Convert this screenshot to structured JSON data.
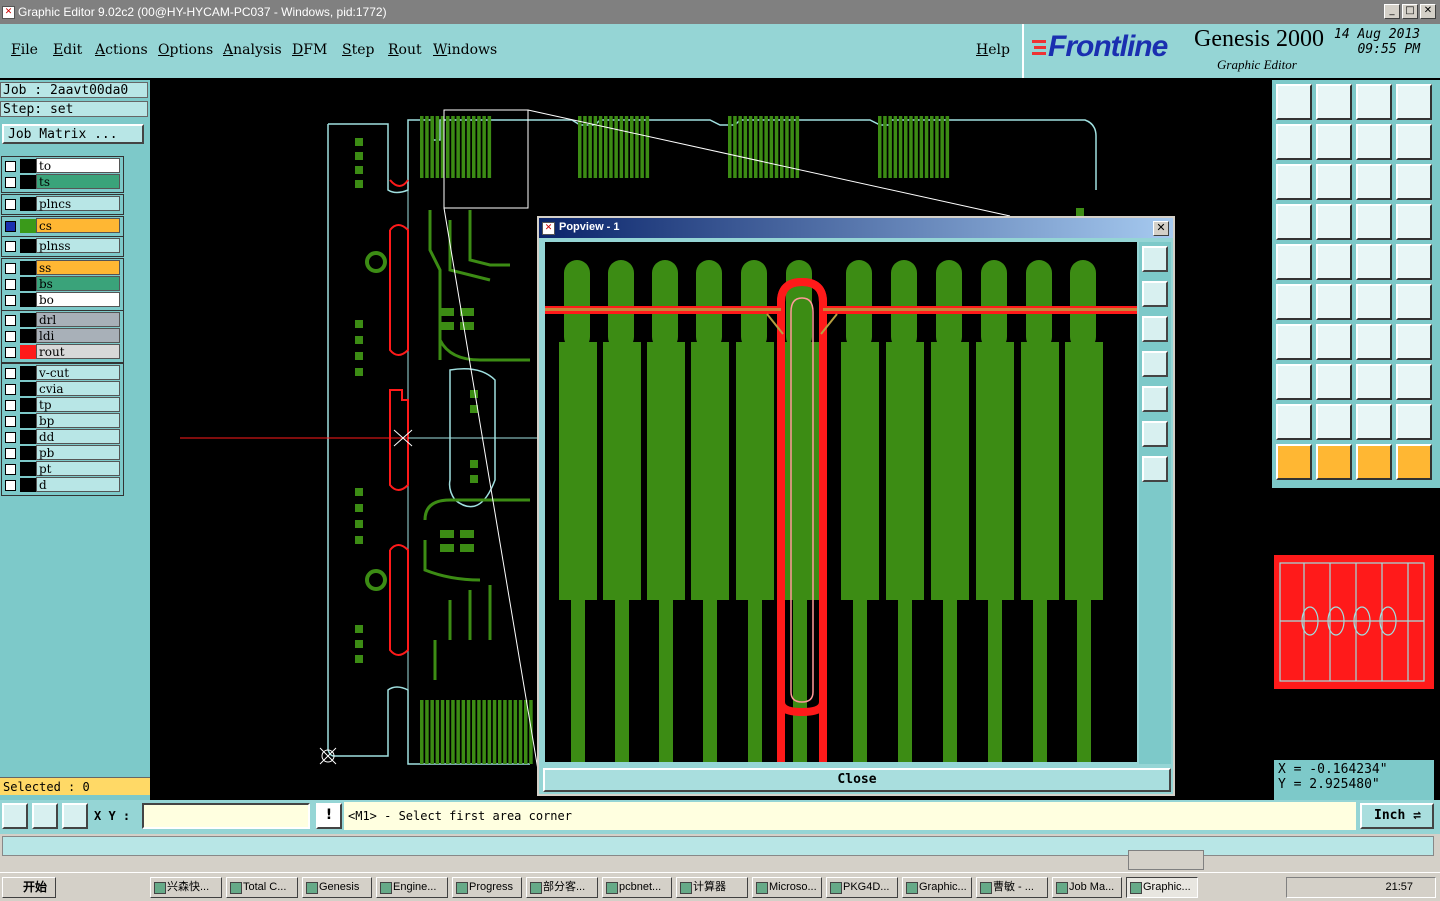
{
  "window": {
    "title": "Graphic Editor 9.02c2 (00@HY-HYCAM-PC037 - Windows, pid:1772)"
  },
  "menu": {
    "items": [
      "File",
      "Edit",
      "Actions",
      "Options",
      "Analysis",
      "DFM",
      "Step",
      "Rout",
      "Windows"
    ],
    "help": "Help"
  },
  "logo": {
    "brand": "Frontline",
    "product": "Genesis 2000",
    "subtitle": "Graphic Editor",
    "date": "14 Aug 2013",
    "time": "09:55 PM"
  },
  "job": {
    "job_line": "Job : 2aavt00da0",
    "step_line": "Step: set",
    "matrix_button": "Job Matrix ..."
  },
  "layers": [
    {
      "name": "to",
      "color": "#ffffff",
      "swatch": "#000000"
    },
    {
      "name": "ts",
      "color": "#3aa37a",
      "swatch": "#000000"
    },
    {
      "name": "plncs",
      "color": "#b8e6e6",
      "swatch": "#000000"
    },
    {
      "name": "cs",
      "color": "#ffb733",
      "swatch": "#3a9a1a"
    },
    {
      "name": "plnss",
      "color": "#b8e6e6",
      "swatch": "#000000"
    },
    {
      "name": "ss",
      "color": "#ffb733",
      "swatch": "#000000"
    },
    {
      "name": "bs",
      "color": "#3aa37a",
      "swatch": "#000000"
    },
    {
      "name": "bo",
      "color": "#ffffff",
      "swatch": "#000000"
    },
    {
      "name": "drl",
      "color": "#a8b0b8",
      "swatch": "#000000"
    },
    {
      "name": "ldi",
      "color": "#a8b0b8",
      "swatch": "#000000"
    },
    {
      "name": "rout",
      "color": "#d8d8d8",
      "swatch": "#ff1a1a"
    },
    {
      "name": "v-cut",
      "color": "#b8e6e6",
      "swatch": "#000000"
    },
    {
      "name": "cvia",
      "color": "#b8e6e6",
      "swatch": "#000000"
    },
    {
      "name": "tp",
      "color": "#b8e6e6",
      "swatch": "#000000"
    },
    {
      "name": "bp",
      "color": "#b8e6e6",
      "swatch": "#000000"
    },
    {
      "name": "dd",
      "color": "#b8e6e6",
      "swatch": "#000000"
    },
    {
      "name": "pb",
      "color": "#b8e6e6",
      "swatch": "#000000"
    },
    {
      "name": "pt",
      "color": "#b8e6e6",
      "swatch": "#000000"
    },
    {
      "name": "d",
      "color": "#b8e6e6",
      "swatch": "#000000"
    }
  ],
  "selected": "Selected : 0",
  "popview": {
    "title": "Popview - 1",
    "close_label": "Close"
  },
  "coords": {
    "x": "X = -0.164234\"",
    "y": "Y = 2.925480\""
  },
  "command": {
    "xy_label": "X Y :",
    "message": "<M1> - Select first area corner",
    "unit": "Inch"
  },
  "taskbar": {
    "start": "开始",
    "tasks": [
      "兴森快...",
      "Total C...",
      "Genesis",
      "Engine...",
      "Progress",
      "部分客...",
      "pcbnet...",
      "计算器",
      "Microso...",
      "PKG4D...",
      "Graphic...",
      "曹敏 - ...",
      "Job Ma...",
      "Graphic..."
    ],
    "clock": "21:57"
  },
  "colors": {
    "trace_green": "#3c8c14",
    "rout_red": "#ff1a1a",
    "outline_cyan": "#a0e0e0",
    "panel_teal": "#7dc9c9"
  }
}
